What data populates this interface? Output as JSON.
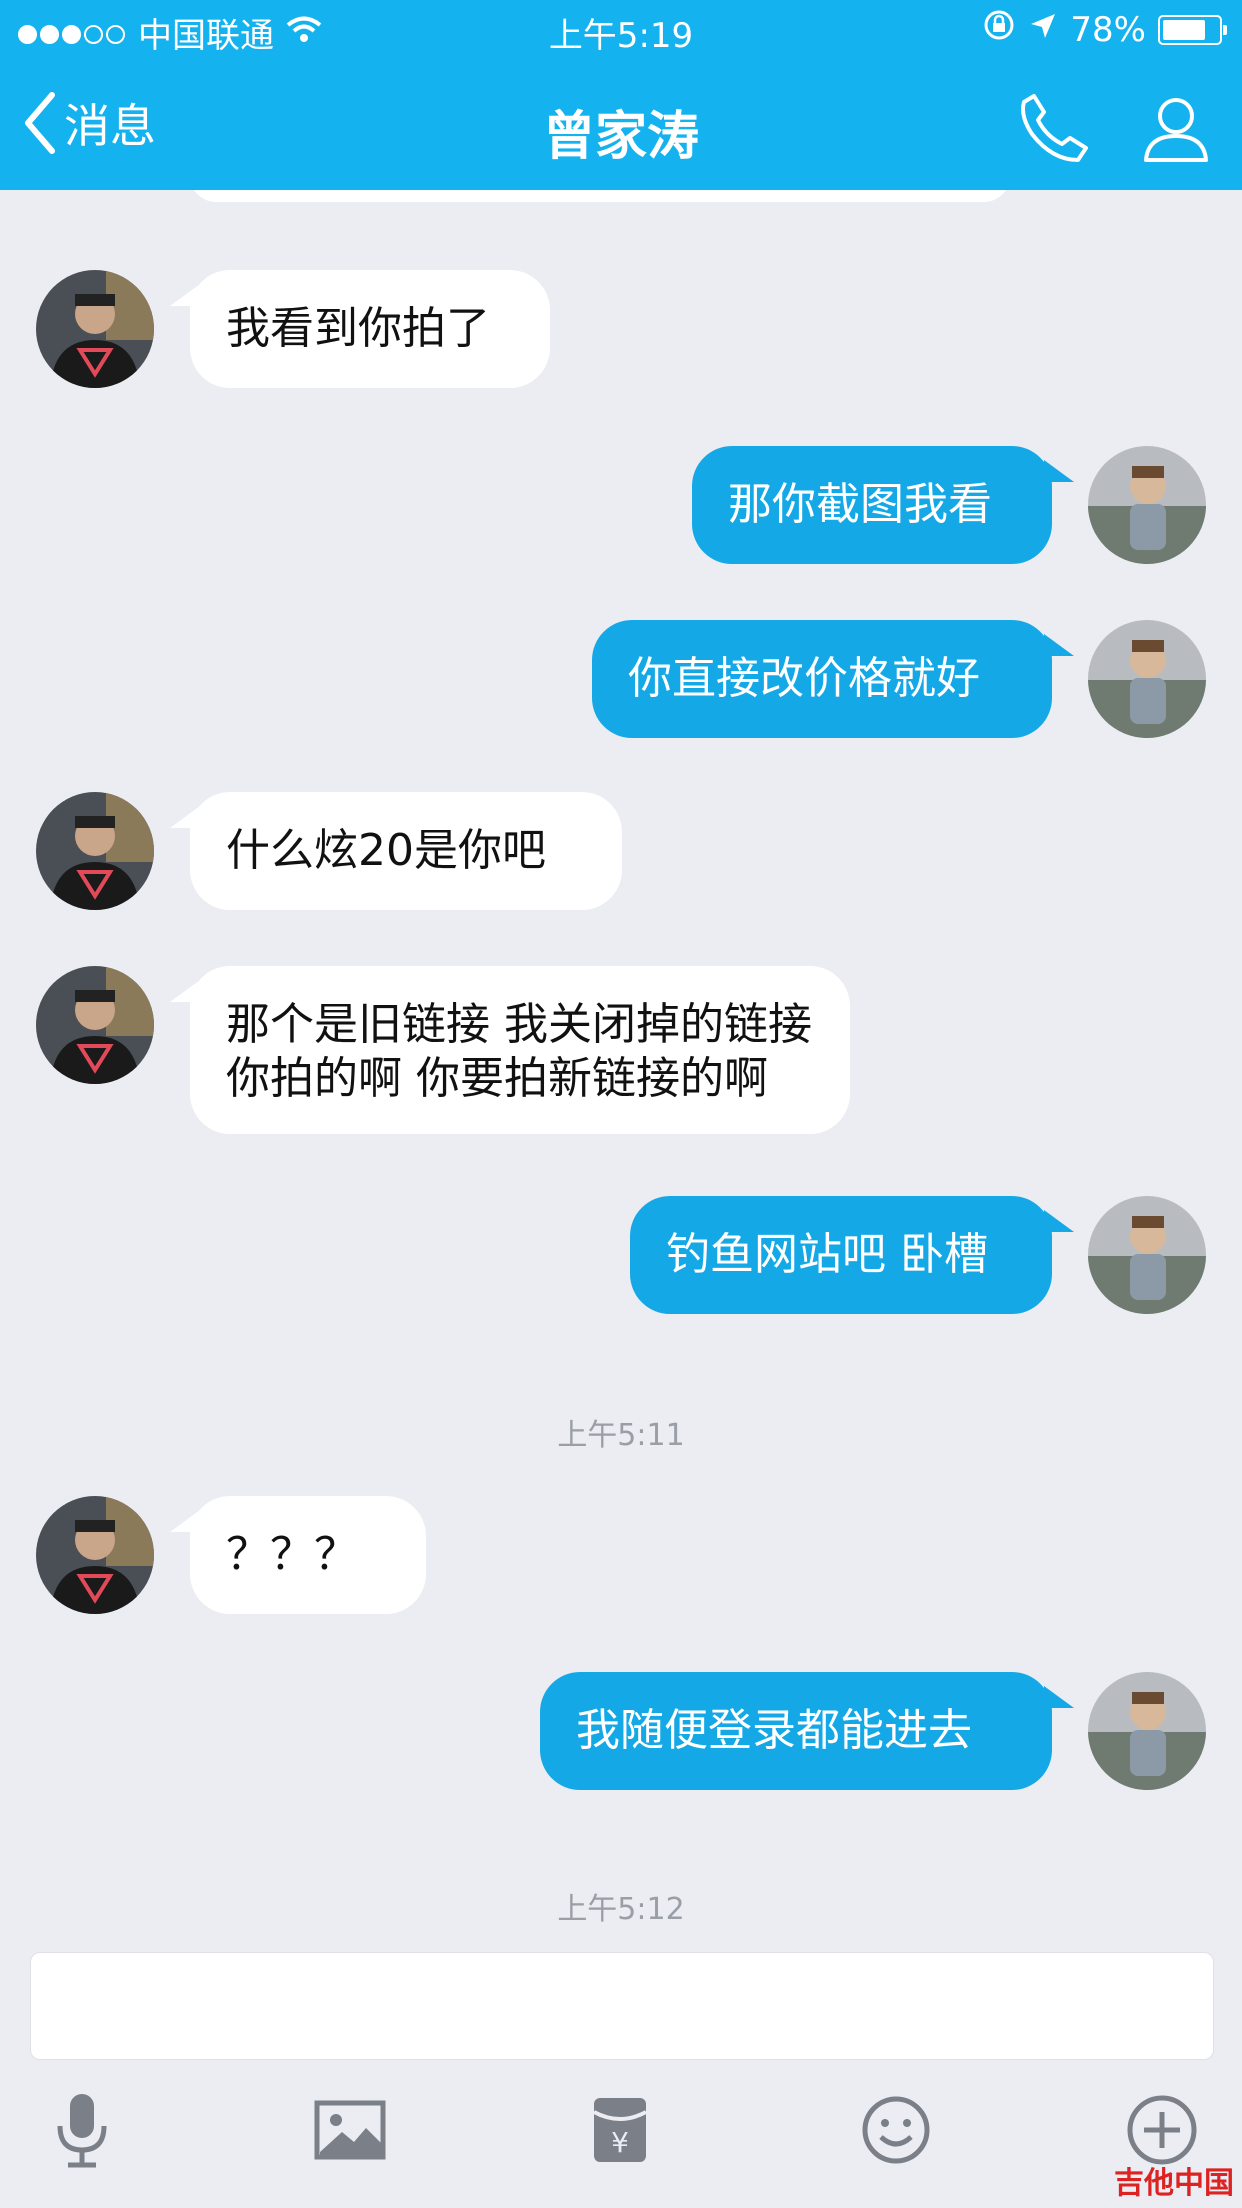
{
  "status": {
    "carrier": "中国联通",
    "time": "上午5:19",
    "battery": "78%",
    "battery_level": 0.78
  },
  "nav": {
    "back_label": "消息",
    "title": "曾家涛"
  },
  "messages": [
    {
      "side": "in",
      "text": "我看到你拍了"
    },
    {
      "side": "out",
      "text": "那你截图我看"
    },
    {
      "side": "out",
      "text": "你直接改价格就好"
    },
    {
      "side": "in",
      "text": "什么炫20是你吧"
    },
    {
      "side": "in",
      "text": "那个是旧链接 我关闭掉的链接 你拍的啊 你要拍新链接的啊"
    },
    {
      "side": "out",
      "text": "钓鱼网站吧 卧槽"
    },
    {
      "side": "in",
      "text": "？？？"
    },
    {
      "side": "out",
      "text": "我随便登录都能进去"
    }
  ],
  "timestamps": [
    "上午5:11",
    "上午5:12"
  ],
  "input": {
    "value": ""
  },
  "toolbar": [
    "mic-icon",
    "image-icon",
    "red-packet-icon",
    "emoji-icon",
    "plus-icon"
  ],
  "watermark": "吉他中国",
  "colors": {
    "accent": "#14b2ee",
    "bubble_out": "#14a8e6",
    "background": "#ebedf2"
  }
}
